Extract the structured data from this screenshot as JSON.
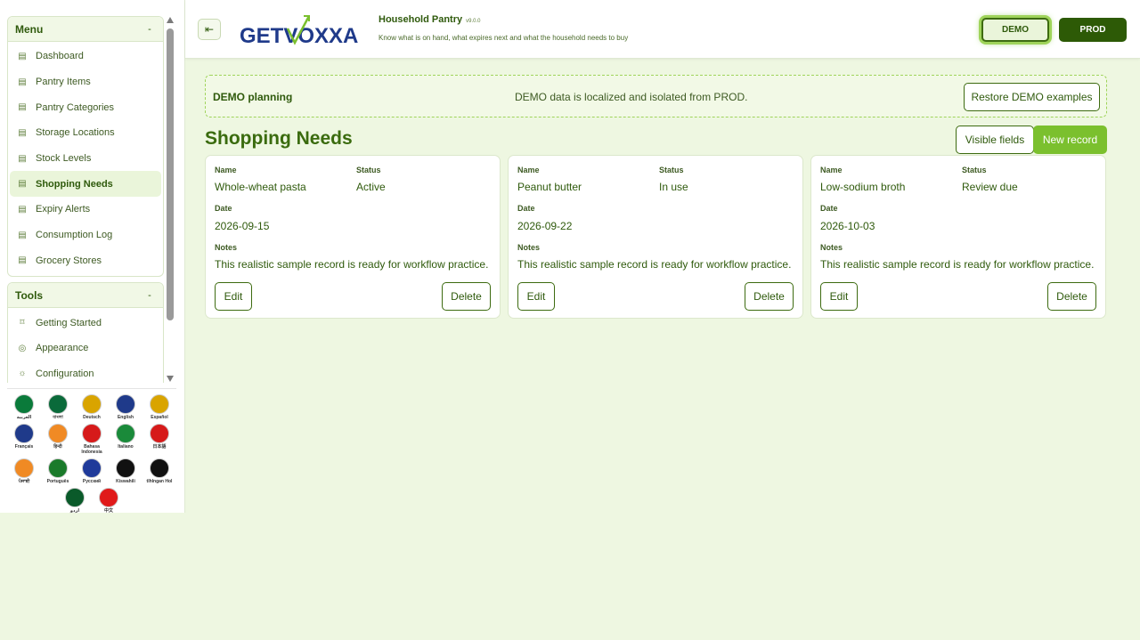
{
  "sidebar": {
    "menu_title": "Menu",
    "menu_collapse": "-",
    "menu_items": [
      {
        "label": "Dashboard",
        "icon": "list-icon"
      },
      {
        "label": "Pantry Items",
        "icon": "list-icon"
      },
      {
        "label": "Pantry Categories",
        "icon": "list-icon"
      },
      {
        "label": "Storage Locations",
        "icon": "list-icon"
      },
      {
        "label": "Stock Levels",
        "icon": "list-icon"
      },
      {
        "label": "Shopping Needs",
        "icon": "list-icon",
        "active": true
      },
      {
        "label": "Expiry Alerts",
        "icon": "list-icon"
      },
      {
        "label": "Consumption Log",
        "icon": "list-icon"
      },
      {
        "label": "Grocery Stores",
        "icon": "list-icon"
      }
    ],
    "tools_title": "Tools",
    "tools_collapse": "-",
    "tools_items": [
      {
        "label": "Getting Started",
        "icon": "start-icon"
      },
      {
        "label": "Appearance",
        "icon": "palette-icon"
      },
      {
        "label": "Configuration",
        "icon": "sun-icon"
      }
    ]
  },
  "languages": [
    {
      "label": "العربية",
      "color": "#0a7a3a"
    },
    {
      "label": "বাংলা",
      "color": "#0a6a3a"
    },
    {
      "label": "Deutsch",
      "color": "#d9a400"
    },
    {
      "label": "English",
      "color": "#1f3a8a"
    },
    {
      "label": "Español",
      "color": "#d9a400"
    },
    {
      "label": "Français",
      "color": "#1f3a8a"
    },
    {
      "label": "हिन्दी",
      "color": "#f08a24"
    },
    {
      "label": "Bahasa Indonesia",
      "color": "#d61a1a"
    },
    {
      "label": "Italiano",
      "color": "#1a8a3a"
    },
    {
      "label": "日本語",
      "color": "#d61a1a"
    },
    {
      "label": "ਪੰਜਾਬੀ",
      "color": "#f08a24"
    },
    {
      "label": "Português",
      "color": "#1a7a2a"
    },
    {
      "label": "Русский",
      "color": "#1f3a9a"
    },
    {
      "label": "Kiswahili",
      "color": "#111111"
    },
    {
      "label": "tlhIngan Hol",
      "color": "#111111"
    },
    {
      "label": "اردو",
      "color": "#0a5a2a"
    },
    {
      "label": "中文",
      "color": "#e01a1a"
    }
  ],
  "header": {
    "toggle_icon": "⇤",
    "logo": "GETVOXXA",
    "app_name": "Household Pantry",
    "version": "v9.0.0",
    "subtitle": "Know what is on hand, what expires next and what the household needs to buy",
    "demo_label": "DEMO",
    "prod_label": "PROD"
  },
  "banner": {
    "label": "DEMO planning",
    "message": "DEMO data is localized and isolated from PROD.",
    "restore_label": "Restore DEMO examples"
  },
  "section": {
    "title": "Shopping Needs",
    "visible_fields_label": "Visible fields",
    "new_record_label": "New record"
  },
  "field_labels": {
    "name": "Name",
    "status": "Status",
    "date": "Date",
    "notes": "Notes"
  },
  "cards": [
    {
      "name": "Whole-wheat pasta",
      "status": "Active",
      "date": "2026-09-15",
      "notes": "This realistic sample record is ready for workflow practice.",
      "edit": "Edit",
      "delete": "Delete"
    },
    {
      "name": "Peanut butter",
      "status": "In use",
      "date": "2026-09-22",
      "notes": "This realistic sample record is ready for workflow practice.",
      "edit": "Edit",
      "delete": "Delete"
    },
    {
      "name": "Low-sodium broth",
      "status": "Review due",
      "date": "2026-10-03",
      "notes": "This realistic sample record is ready for workflow practice.",
      "edit": "Edit",
      "delete": "Delete"
    }
  ],
  "colors": {
    "accent": "#7bc02e",
    "dark": "#2d5a06",
    "background": "#eef7e1"
  }
}
